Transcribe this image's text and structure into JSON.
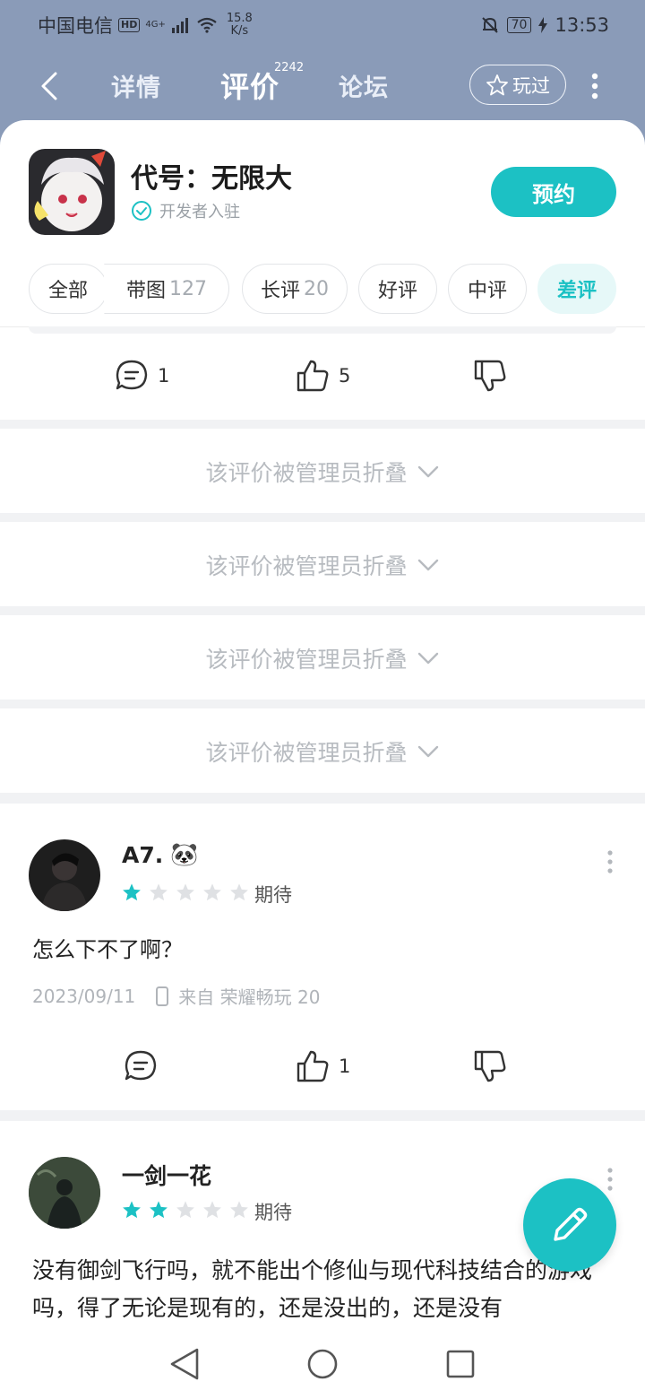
{
  "status_bar": {
    "carrier": "中国电信",
    "hd": "HD",
    "network": "4G+",
    "speed_value": "15.8",
    "speed_unit": "K/s",
    "battery": "70",
    "time": "13:53"
  },
  "nav": {
    "tabs": [
      {
        "label": "详情"
      },
      {
        "label": "评价"
      },
      {
        "label": "论坛"
      }
    ],
    "review_count_badge": "2242",
    "played_label": "玩过"
  },
  "game": {
    "title": "代号：无限大",
    "dev_label": "开发者入驻",
    "reserve_label": "预约"
  },
  "filters": [
    {
      "label": "全部",
      "count": ""
    },
    {
      "label": "带图",
      "count": "127"
    },
    {
      "label": "长评",
      "count": "20"
    },
    {
      "label": "好评",
      "count": ""
    },
    {
      "label": "中评",
      "count": ""
    },
    {
      "label": "差评",
      "count": ""
    }
  ],
  "top_actions": {
    "comments": "1",
    "likes": "5"
  },
  "folded_text": "该评价被管理员折叠",
  "reviews": [
    {
      "user": "A7.",
      "emoji": "🐼",
      "rating": 1,
      "rating_label": "期待",
      "text": "怎么下不了啊？",
      "date": "2023/09/11",
      "device": "来自 荣耀畅玩 20",
      "comments": "",
      "likes": "1"
    },
    {
      "user": "一剑一花",
      "rating": 2,
      "rating_label": "期待",
      "text": "没有御剑飞行吗，就不能出个修仙与现代科技结合的游戏吗，得了无论是现有的，还是没出的，还是没有"
    }
  ],
  "colors": {
    "accent": "#1cc1c4",
    "header_bg": "#8a9bb8",
    "star_off": "#dfe1e4"
  }
}
